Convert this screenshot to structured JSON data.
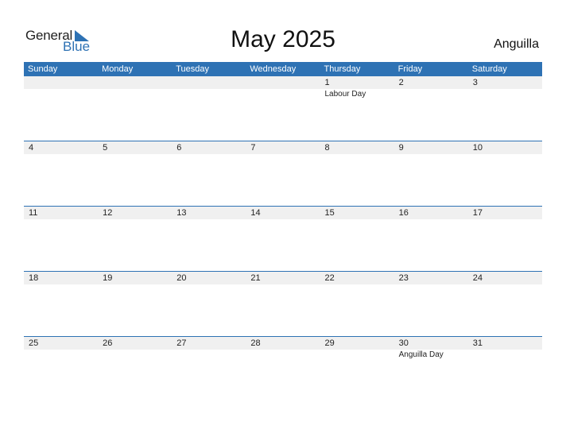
{
  "logo": {
    "general": "General",
    "blue": "Blue"
  },
  "title": "May 2025",
  "country": "Anguilla",
  "colors": {
    "accent": "#2e72b4",
    "strip": "#f0f0f0"
  },
  "weekdays": [
    "Sunday",
    "Monday",
    "Tuesday",
    "Wednesday",
    "Thursday",
    "Friday",
    "Saturday"
  ],
  "weeks": [
    [
      {
        "d": ""
      },
      {
        "d": ""
      },
      {
        "d": ""
      },
      {
        "d": ""
      },
      {
        "d": "1",
        "ev": "Labour Day"
      },
      {
        "d": "2"
      },
      {
        "d": "3"
      }
    ],
    [
      {
        "d": "4"
      },
      {
        "d": "5"
      },
      {
        "d": "6"
      },
      {
        "d": "7"
      },
      {
        "d": "8"
      },
      {
        "d": "9"
      },
      {
        "d": "10"
      }
    ],
    [
      {
        "d": "11"
      },
      {
        "d": "12"
      },
      {
        "d": "13"
      },
      {
        "d": "14"
      },
      {
        "d": "15"
      },
      {
        "d": "16"
      },
      {
        "d": "17"
      }
    ],
    [
      {
        "d": "18"
      },
      {
        "d": "19"
      },
      {
        "d": "20"
      },
      {
        "d": "21"
      },
      {
        "d": "22"
      },
      {
        "d": "23"
      },
      {
        "d": "24"
      }
    ],
    [
      {
        "d": "25"
      },
      {
        "d": "26"
      },
      {
        "d": "27"
      },
      {
        "d": "28"
      },
      {
        "d": "29"
      },
      {
        "d": "30",
        "ev": "Anguilla Day"
      },
      {
        "d": "31"
      }
    ]
  ]
}
